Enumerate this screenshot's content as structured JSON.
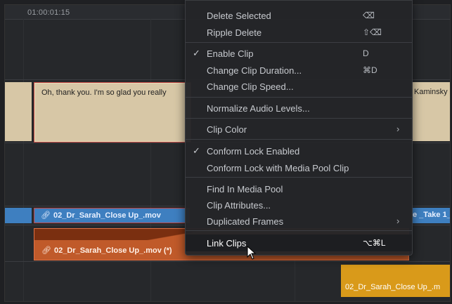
{
  "ruler": {
    "timecode": "01:00:01:15"
  },
  "clips": {
    "subtitle_main": "Oh, thank you. I'm so glad you really",
    "subtitle_right": "Kaminsky",
    "video_main": "02_Dr_Sarah_Close Up_.mov",
    "video_right": "e _Take 1_",
    "audio_main": "02_Dr_Sarah_Close Up_.mov (*)",
    "yellow": "02_Dr_Sarah_Close Up_.m"
  },
  "menu": {
    "items": [
      {
        "label": "Delete Selected",
        "shortcut": "⌫"
      },
      {
        "label": "Ripple Delete",
        "shortcut": "⇧⌫"
      },
      {
        "label": "Enable Clip",
        "shortcut": "D",
        "checked": "✓"
      },
      {
        "label": "Change Clip Duration...",
        "shortcut": "⌘D"
      },
      {
        "label": "Change Clip Speed..."
      },
      {
        "label": "Normalize Audio Levels..."
      },
      {
        "label": "Clip Color",
        "submenu": "›"
      },
      {
        "label": "Conform Lock Enabled",
        "checked": "✓"
      },
      {
        "label": "Conform Lock with Media Pool Clip"
      },
      {
        "label": "Find In Media Pool"
      },
      {
        "label": "Clip Attributes..."
      },
      {
        "label": "Duplicated Frames",
        "submenu": "›"
      },
      {
        "label": "Link Clips",
        "shortcut": "⌥⌘L"
      }
    ]
  },
  "colors": {
    "accent_orange": "#c05a2a",
    "accent_blue": "#3e7fc0",
    "subtitle_bg": "#d7c7a6"
  },
  "icons": {
    "link": "link-icon",
    "check": "check-icon",
    "chevron": "chevron-right-icon",
    "cursor": "pointer-cursor-icon"
  }
}
